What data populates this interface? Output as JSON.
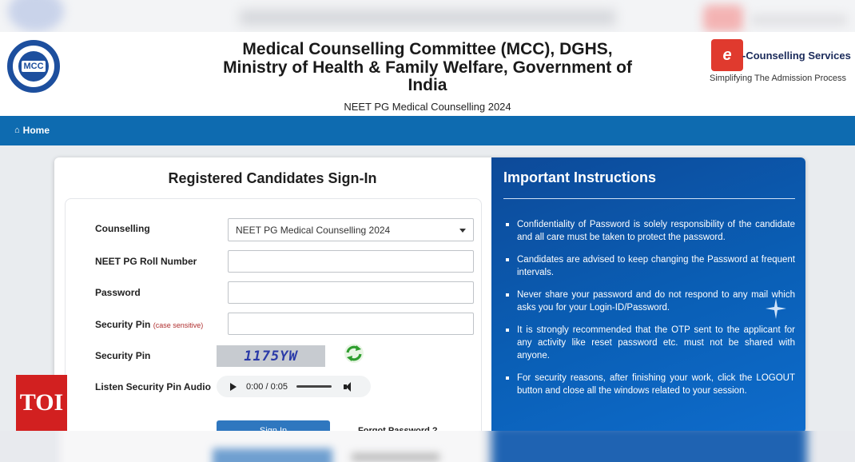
{
  "header": {
    "title": "Medical Counselling Committee (MCC), DGHS, Ministry of Health & Family Welfare, Government of India",
    "subtitle": "NEET PG Medical Counselling 2024",
    "logo_text": "MCC",
    "partner_name": "-Counselling Services",
    "partner_tagline": "Simplifying The Admission Process",
    "partner_logo_text": "e"
  },
  "nav": {
    "home_label": "Home",
    "home_icon": "home-icon"
  },
  "signin": {
    "title": "Registered Candidates Sign-In",
    "fields": {
      "counselling_label": "Counselling",
      "counselling_value": "NEET PG Medical Counselling 2024",
      "roll_label": "NEET PG Roll Number",
      "roll_value": "",
      "password_label": "Password",
      "password_value": "",
      "security_pin_input_label": "Security Pin",
      "security_pin_note": "(case sensitive)",
      "security_pin_value": "",
      "security_pin_image_label": "Security Pin",
      "captcha_text": "1175YW",
      "audio_label": "Listen Security Pin Audio",
      "audio_time": "0:00 / 0:05"
    },
    "sign_in_button": "Sign In",
    "forgot_link": "Forgot Password ?"
  },
  "instructions": {
    "title": "Important Instructions",
    "items": [
      "Confidentiality of Password is solely responsibility of the candidate and all care must be taken to protect the password.",
      "Candidates are advised to keep changing the Password at frequent intervals.",
      "Never share your password and do not respond to any mail which asks you for your Login-ID/Password.",
      "It is strongly recommended that the OTP sent to the applicant for any activity like reset password etc. must not be shared with anyone.",
      "For security reasons, after finishing your work, click the LOGOUT button and close all the windows related to your session."
    ]
  },
  "watermark": {
    "text": "TOI"
  },
  "colors": {
    "nav_bar": "#0e6bb0",
    "instructions_panel": "#0a5fb6",
    "sign_in_button": "#2f77bf",
    "watermark": "#d22020"
  }
}
